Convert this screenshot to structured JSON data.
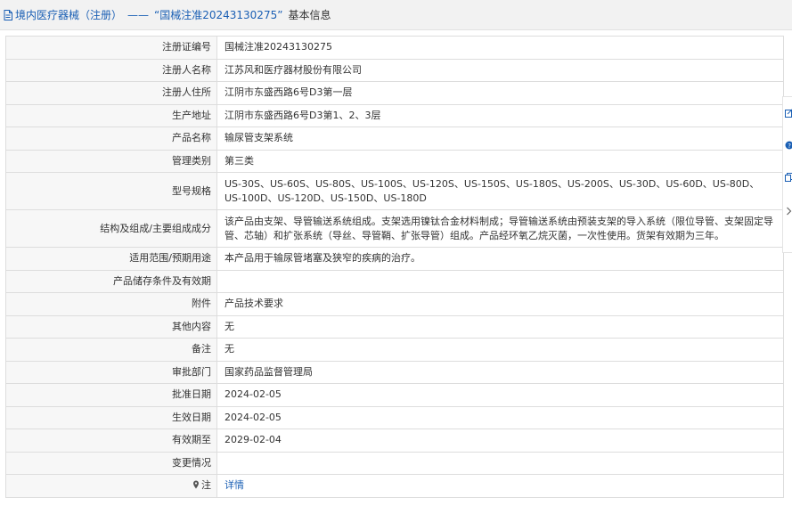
{
  "header": {
    "category": "境内医疗器械（注册）",
    "separator": "——",
    "reg_no_title": "“国械注准20243130275”",
    "suffix": "基本信息"
  },
  "rows": [
    {
      "label": "注册证编号",
      "value": "国械注准20243130275"
    },
    {
      "label": "注册人名称",
      "value": "江苏风和医疗器材股份有限公司"
    },
    {
      "label": "注册人住所",
      "value": "江阴市东盛西路6号D3第一层"
    },
    {
      "label": "生产地址",
      "value": "江阴市东盛西路6号D3第1、2、3层"
    },
    {
      "label": "产品名称",
      "value": "输尿管支架系统"
    },
    {
      "label": "管理类别",
      "value": "第三类"
    },
    {
      "label": "型号规格",
      "value": "US-30S、US-60S、US-80S、US-100S、US-120S、US-150S、US-180S、US-200S、US-30D、US-60D、US-80D、US-100D、US-120D、US-150D、US-180D"
    },
    {
      "label": "结构及组成/主要组成成分",
      "value": "该产品由支架、导管输送系统组成。支架选用镍钛合金材料制成；导管输送系统由预装支架的导入系统（限位导管、支架固定导管、芯轴）和扩张系统（导丝、导管鞘、扩张导管）组成。产品经环氧乙烷灭菌，一次性使用。货架有效期为三年。"
    },
    {
      "label": "适用范围/预期用途",
      "value": "本产品用于输尿管堵塞及狭窄的疾病的治疗。"
    },
    {
      "label": "产品储存条件及有效期",
      "value": ""
    },
    {
      "label": "附件",
      "value": "产品技术要求"
    },
    {
      "label": "其他内容",
      "value": "无"
    },
    {
      "label": "备注",
      "value": "无"
    },
    {
      "label": "审批部门",
      "value": "国家药品监督管理局"
    },
    {
      "label": "批准日期",
      "value": "2024-02-05"
    },
    {
      "label": "生效日期",
      "value": "2024-02-05"
    },
    {
      "label": "有效期至",
      "value": "2029-02-04"
    },
    {
      "label": "变更情况",
      "value": ""
    }
  ],
  "note": {
    "label": "注",
    "link": "详情"
  }
}
